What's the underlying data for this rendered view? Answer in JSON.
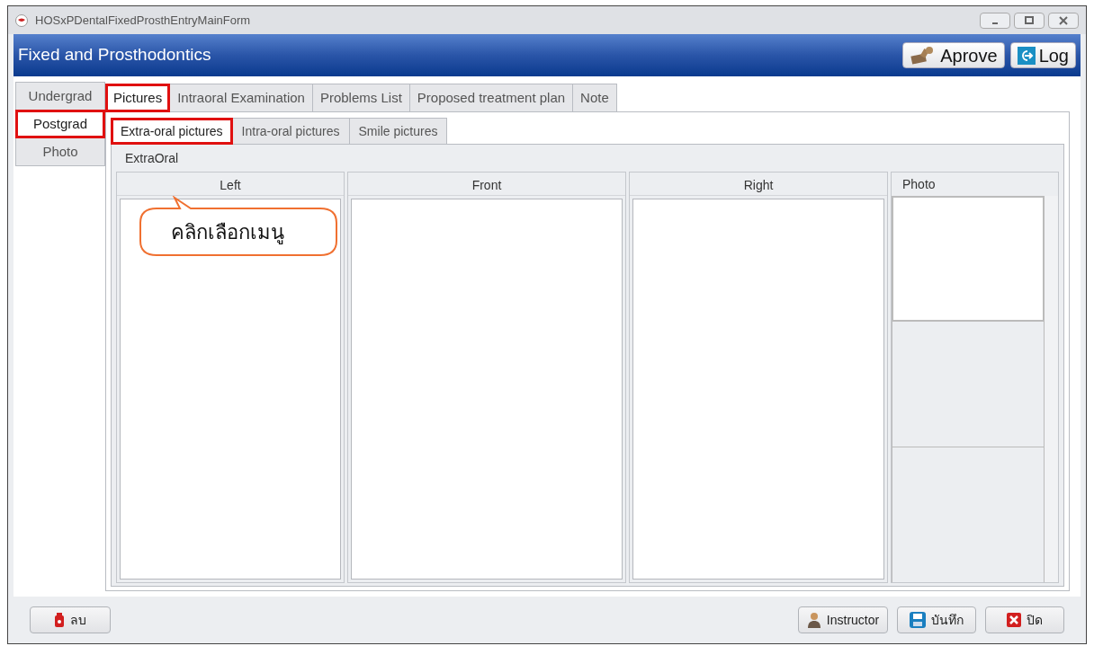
{
  "window": {
    "title": "HOSxPDentalFixedProsthEntryMainForm"
  },
  "header": {
    "title": "Fixed and Prosthodontics",
    "buttons": [
      {
        "label": "Aprove",
        "kind": "stamp"
      },
      {
        "label": "Log",
        "kind": "log"
      }
    ]
  },
  "side_tabs": [
    {
      "label": "Undergrad",
      "selected": false,
      "highlighted": false
    },
    {
      "label": "Postgrad",
      "selected": true,
      "highlighted": true
    },
    {
      "label": "Photo",
      "selected": false,
      "highlighted": false
    }
  ],
  "tabs": [
    {
      "label": "Pictures",
      "selected": true,
      "highlighted": true
    },
    {
      "label": "Intraoral Examination",
      "selected": false,
      "highlighted": false
    },
    {
      "label": "Problems List",
      "selected": false,
      "highlighted": false
    },
    {
      "label": "Proposed treatment plan",
      "selected": false,
      "highlighted": false
    },
    {
      "label": "Note",
      "selected": false,
      "highlighted": false
    }
  ],
  "sub_tabs": [
    {
      "label": "Extra-oral pictures",
      "selected": true,
      "highlighted": true
    },
    {
      "label": "Intra-oral pictures",
      "selected": false,
      "highlighted": false
    },
    {
      "label": "Smile pictures",
      "selected": false,
      "highlighted": false
    }
  ],
  "group": {
    "title": "ExtraOral",
    "panels": [
      {
        "title": "Left"
      },
      {
        "title": "Front"
      },
      {
        "title": "Right"
      }
    ],
    "photo": {
      "title": "Photo"
    }
  },
  "callout": {
    "text": "คลิกเลือกเมนู"
  },
  "footer": {
    "buttons": [
      {
        "label": "ลบ",
        "kind": "delete"
      },
      {
        "label": "Instructor",
        "kind": "instructor"
      },
      {
        "label": "บันทึก",
        "kind": "save"
      },
      {
        "label": "ปิด",
        "kind": "close"
      }
    ]
  }
}
